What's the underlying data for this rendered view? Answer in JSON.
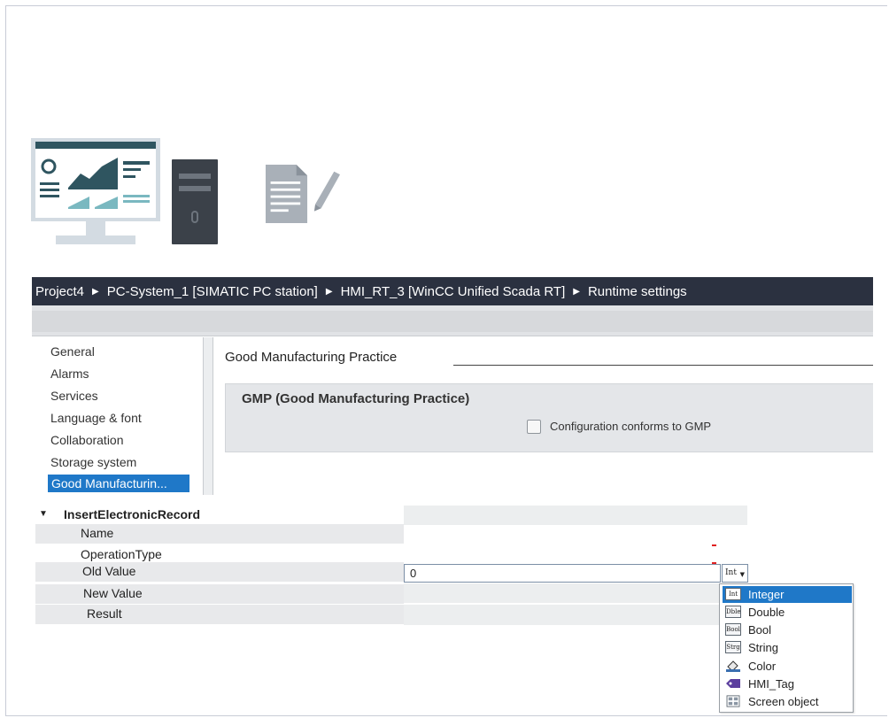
{
  "breadcrumb": {
    "items": [
      "Project4",
      "PC-System_1 [SIMATIC PC station]",
      "HMI_RT_3 [WinCC Unified Scada RT]",
      "Runtime settings"
    ]
  },
  "nav": {
    "items": [
      {
        "label": "General"
      },
      {
        "label": "Alarms"
      },
      {
        "label": "Services"
      },
      {
        "label": "Language & font"
      },
      {
        "label": "Collaboration"
      },
      {
        "label": "Storage system"
      },
      {
        "label": "Good Manufacturin...",
        "selected": true
      }
    ]
  },
  "content": {
    "section_title": "Good Manufacturing Practice",
    "gmp_group_title": "GMP (Good Manufacturing Practice)",
    "checkbox_label": "Configuration conforms to GMP",
    "checkbox_checked": false
  },
  "grid": {
    "root_label": "InsertElectronicRecord",
    "rows": [
      {
        "label": "Name"
      },
      {
        "label": "OperationType"
      },
      {
        "label": "Old Value"
      },
      {
        "label": "New Value"
      },
      {
        "label": "Result"
      }
    ],
    "old_value": "0",
    "type_button": "Int"
  },
  "type_dropdown": {
    "options": [
      {
        "label": "Integer",
        "icon": "Int",
        "selected": true
      },
      {
        "label": "Double",
        "icon": "Dble"
      },
      {
        "label": "Bool",
        "icon": "Bool"
      },
      {
        "label": "String",
        "icon": "Strg"
      },
      {
        "label": "Color",
        "icon": "color-icon"
      },
      {
        "label": "HMI_Tag",
        "icon": "hmi-tag-icon"
      },
      {
        "label": "Screen object",
        "icon": "screen-object-icon"
      }
    ]
  },
  "colors": {
    "breadcrumb_bg": "#2b3140",
    "selection": "#1f78c8",
    "panel_gray": "#e4e6e9"
  }
}
